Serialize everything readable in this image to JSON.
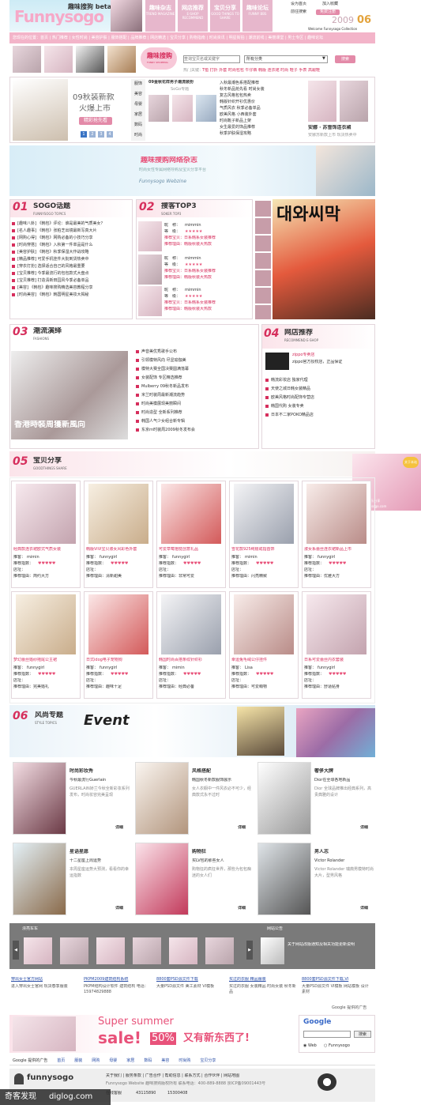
{
  "header": {
    "logo": "Funnysogo",
    "beta": "趣味搜狗 beta",
    "nav": [
      {
        "cn": "趣味杂志",
        "en": "TREND MAGAZINE"
      },
      {
        "cn": "网店推荐",
        "en": "E-SHOP RECOMMEND"
      },
      {
        "cn": "宝贝分享",
        "en": "GOOD THINGS TO SHARE"
      },
      {
        "cn": "趣味论坛",
        "en": "FUNNY BBS"
      }
    ],
    "top_links": [
      "设为首页",
      "加入收藏"
    ],
    "year": "2009",
    "year_num": "06",
    "welcome": "Welcome Funnysogo Collection",
    "top_tags": "前往搜索",
    "login": "免费注册"
  },
  "pinkbar": "您现在的位置：首页 | 热门推荐 | 女性时尚 | 美容护肤 | 服饰搭配 | 品牌推荐 | 网店精选 | 宝贝分享 | 购物指南 | 时尚资讯 | 明星街拍 | 潮流前线 | 美丽课堂 | 男士专区 | 趣味论坛",
  "search": {
    "title_cn": "趣味搜购",
    "title_en": "FUNNY SHOPPING",
    "placeholder": "查询宝贝名或关键字",
    "category": "所有分类",
    "button": "搜索",
    "hot_label": "热门关键：",
    "hot": "T恤 打折 外套 时尚包包 牛仔裤 韩版 连衣裙 时尚 鞋子 手表 高跟鞋"
  },
  "promo": {
    "title": "09秋装新款",
    "subtitle": "火爆上市",
    "tag": "精彩抢先看",
    "pages": [
      "1",
      "2",
      "3",
      "4"
    ],
    "side_tabs": [
      "服饰",
      "美容",
      "母婴",
      "家居",
      "数码",
      "时尚"
    ],
    "product_title": "09金秋花样男子潮流装扮",
    "product_sub": "SoGo专题",
    "list": [
      "入秋最潮色系搭配推荐",
      "秋冬新品抢先看 时尚女装",
      "复古风格包包热卖",
      "韩版针织开衫优惠价",
      "气质风衣 秋季必备单品",
      "欧美风格 小西装外套",
      "时尚靴子新品上架",
      "女生最爱的饰品推荐",
      "秋季护肤保湿攻略"
    ],
    "right_title": "安娜 · 苏雪饰连衣裙",
    "right_sub": "安娜苏新款上市 现货热卖中"
  },
  "magazine": {
    "title": "趣味搜购网络杂志",
    "sub": "时尚女性专属网络导购及宝贝分享平台",
    "en": "Funnysogo Webzine"
  },
  "s01": {
    "num": "01",
    "title": "SOGO话题",
    "sub": "FUNNYSOGO TOPICS",
    "items": [
      "[趣味八卦] 《韩包》评论：谁是最美的气质美女？",
      "[名人趣事] 《韩包》张柏芝出镜最新写真大片",
      "[网购心得] 《韩包》网购必备的小技巧分享",
      "[时尚穿搭] 《韩包》入秋第一件单品是什么",
      "[美容护肤] 《韩包》秋季保湿大作战攻略",
      "[精品推荐] 可爱手机挂件大批到货热卖中",
      "[穿衣打扮] 选择适合自己的风格最重要",
      "[宝贝推荐] 今季最流行的包包款式大盘点",
      "[宝贝推荐] 打造清新田园风今季必备单品",
      "[美容] 《韩包》趣味搜购精选美容教程分享",
      "[时尚美容] 《韩包》韩国明星美妆大揭秘"
    ]
  },
  "s02": {
    "num": "02",
    "title": "搜客TOP3",
    "sub": "SOKER TOP3",
    "users": [
      {
        "name": "mimmin",
        "level": "★★★★★",
        "rec": "推荐宝贝：日系韩系女装推荐",
        "desc": "推荐理由：韩版秋装大热款"
      },
      {
        "name": "mimmin",
        "level": "★★★★★",
        "rec": "推荐宝贝：日系韩系女装推荐",
        "desc": "推荐理由：韩版秋装大热款"
      },
      {
        "name": "mimmin",
        "level": "★★★★★",
        "rec": "推荐宝贝：日系韩系女装推荐",
        "desc": "推荐理由：韩版秋装大热款"
      }
    ],
    "labels": {
      "nick": "昵　称：",
      "level": "等　级："
    },
    "poster_text": "대와씨막"
  },
  "s03": {
    "num": "03",
    "title": "潮流演绎",
    "sub": "FASHIONS",
    "banner": "香港時裝周獲新風向",
    "items": [
      "声音美优秀歌手公布",
      "引领模特风向 尽显瑜伽美",
      "模特大赛全国决赛圆满落幕",
      "女装配饰 专区精选推荐",
      "Mulberry 09秋冬新品发布",
      "米兰时装周最新潮流趋势",
      "时尚美模展现美丽瞬间",
      "时尚造型 全新系列推荐",
      "韩国人气少女组合新专辑",
      "东京rn时装周2009秋冬发布会"
    ]
  },
  "s04": {
    "num": "04",
    "title": "网店推荐",
    "sub": "RECOMMEND E-SHOP",
    "shop1": "zippo专卖店",
    "shop1_desc": "zippo官方授权店，正品保证",
    "items": [
      "韩流彩妆店 独家代理",
      "天使之城日韩女装精品",
      "欧美风格时尚配饰专营店",
      "韩国代购 女装专卖",
      "日本不二家POKO精品店"
    ]
  },
  "s05": {
    "num": "05",
    "title": "宝贝分享",
    "sub": "GOODTHINGS SHARE",
    "row1": [
      {
        "title": "经典款连衣裙欧式气质女装",
        "user": "mimin",
        "note": "推荐理由：简约大方"
      },
      {
        "title": "韩版ViVi宝贝淑女风彩色外套",
        "user": "funnygirl",
        "note": "推荐理由：清新甜美"
      },
      {
        "title": "可爱草莓抱枕创意礼品",
        "user": "funnygirl",
        "note": "推荐理由：非常可爱"
      },
      {
        "title": "雪花款925纯银戒指首饰",
        "user": "mimin",
        "note": "推荐理由：闪亮精致"
      },
      {
        "title": "淑女系蕾丝连衣裙新品上市",
        "user": "funnygirl",
        "note": "推荐理由：优雅大方"
      }
    ],
    "row2": [
      {
        "title": "梦幻蕾丝婚纱拖尾公主裙",
        "user": "funnygirl",
        "note": "推荐理由：完美婚礼"
      },
      {
        "title": "日式idog电子宠物狗",
        "user": "funnygirl",
        "note": "推荐理由：趣味十足"
      },
      {
        "title": "韩国时尚百搭条纹针织衫",
        "user": "mimin",
        "note": "推荐理由：经典必备"
      },
      {
        "title": "幸运兔毛绒公仔挂件",
        "user": "Lisa",
        "note": "推荐理由：可爱萌物"
      },
      {
        "title": "日系可爱蕾丝内衣套装",
        "user": "funnygirl",
        "note": "推荐理由：舒适贴身"
      }
    ],
    "labels": {
      "user": "推客：",
      "score": "推荐指数：",
      "shop": "店址："
    },
    "hearts": "♥♥♥♥♥",
    "promo": "国民宝贝·快乐分享",
    "promo_url": "www.funnysogo.com",
    "badge": "关于本站"
  },
  "s06": {
    "num": "06",
    "title": "风尚专题",
    "sub": "STYLE TOPICS",
    "event": "Event",
    "topics": [
      {
        "title": "时尚彩妆秀",
        "sub": "今秋最流行Guerlain",
        "body": "GUERLAIN娇兰今秋全新彩妆系列发布，时尚妆容完美呈现",
        "more": "详细"
      },
      {
        "title": "风格搭配",
        "sub": "韩国秋冬新款服饰展示",
        "body": "女人衣橱中一件风衣必不可少，经典款式永不过时",
        "more": "详细"
      },
      {
        "title": "奢侈大牌",
        "sub": "Dior在全球各地新品",
        "body": "Dior 全球品牌推出经典系列，高贵典雅的设计",
        "more": "详细"
      },
      {
        "title": "星语星愿",
        "sub": "十二星座上周运势",
        "body": "本周星座运势大预测，看看你的幸运指数",
        "more": "详细"
      },
      {
        "title": "购物狂",
        "sub": "买LV包的那些女人",
        "body": "购物狂的疯狂世界，那些为包包痴迷的女人们",
        "more": "详细"
      },
      {
        "title": "男人志",
        "sub": "Victor Rolander",
        "body": "Victor Rolander 瑞典男模特时尚大片，型男风格",
        "more": "详细"
      }
    ]
  },
  "gray_section": {
    "left_title": "漂亮车车",
    "right_title": "网站公告",
    "notice": "关于网站改版通知及相关功能更新说明"
  },
  "ads": [
    {
      "title": "穿出女士官方网站",
      "body": "进入穿出女士官网 现货春季服装"
    },
    {
      "title": "PKPM2009建筑结构系统",
      "body": "PKPM结构设计软件 建筑结构 电话：15974829888"
    },
    {
      "title": "8800套PSD源文件下载",
      "body": "大量PSD源文件 美工素材 VI模板"
    },
    {
      "title": "买过的衣服 精品服装",
      "body": "买过的衣服 女装精品 时尚女装 秋冬新品"
    },
    {
      "title": "8800套PSD源文件下载,VI",
      "body": "大量PSD源文件 VI模板 网站模板 设计素材"
    }
  ],
  "google_ads": "Google 提供的广告",
  "sale": {
    "super": "Super summer",
    "sale": "sale!",
    "pct": "50%",
    "cn": "又有新东西了!"
  },
  "gsearch": {
    "logo": "Google",
    "btn": "搜索",
    "opt1": "Web",
    "opt2": "Funnysogo"
  },
  "bottom_nav": [
    "Google 提供的广告",
    "首页",
    "服装",
    "网购",
    "母婴",
    "家居",
    "数码",
    "美容",
    "时尚购",
    "宝贝分享"
  ],
  "footer": {
    "logo": "funnysogo",
    "links": "关于我们 | 服务条款 | 广告合作 | 帮助信息 | 联系方式 | 合作伙伴 | 网站地图",
    "copy": "Funnysogo Website 趣味搜购版权所有 联系电话：400-889-8888 京ICP备09001443号",
    "qq_label": "在线客服",
    "qq1": "43115890",
    "qq2": "15300408"
  },
  "watermark": {
    "cn": "奇客发现",
    "url": "diglog.com"
  }
}
